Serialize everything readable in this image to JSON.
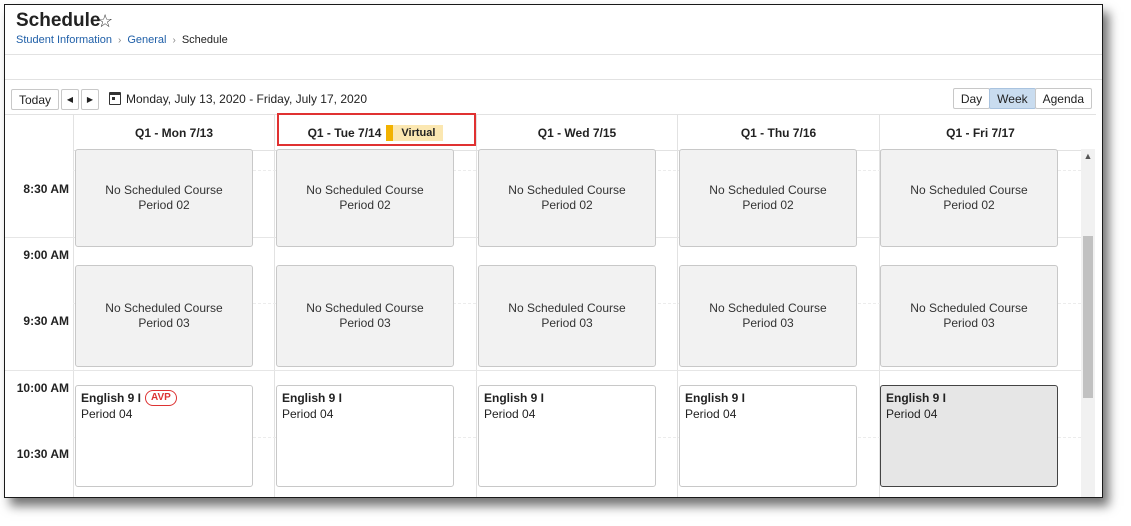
{
  "header": {
    "title": "Schedule",
    "breadcrumb": [
      "Student Information",
      "General",
      "Schedule"
    ]
  },
  "toolbar": {
    "today_label": "Today",
    "date_range": "Monday, July 13, 2020 - Friday, July 17, 2020",
    "views": [
      "Day",
      "Week",
      "Agenda"
    ],
    "active_view": "Week"
  },
  "days": [
    {
      "label": "Q1 - Mon 7/13"
    },
    {
      "label": "Q1 - Tue 7/14",
      "badge": "Virtual"
    },
    {
      "label": "Q1 - Wed 7/15"
    },
    {
      "label": "Q1 - Thu 7/16"
    },
    {
      "label": "Q1 - Fri 7/17"
    }
  ],
  "times": [
    "8:30 AM",
    "9:00 AM",
    "9:30 AM",
    "10:00 AM",
    "10:30 AM"
  ],
  "events": {
    "no_course": "No Scheduled Course",
    "period_02": "Period 02",
    "period_03": "Period 03",
    "course": "English 9 I",
    "period_04": "Period 04",
    "avp_badge": "AVP"
  },
  "colors": {
    "accent": "#c9dcef",
    "link": "#1f5fa8",
    "highlight": "#e03131",
    "virtual_bg": "#fbe7b1",
    "virtual_bar": "#f2b200",
    "avp": "#d33333"
  }
}
